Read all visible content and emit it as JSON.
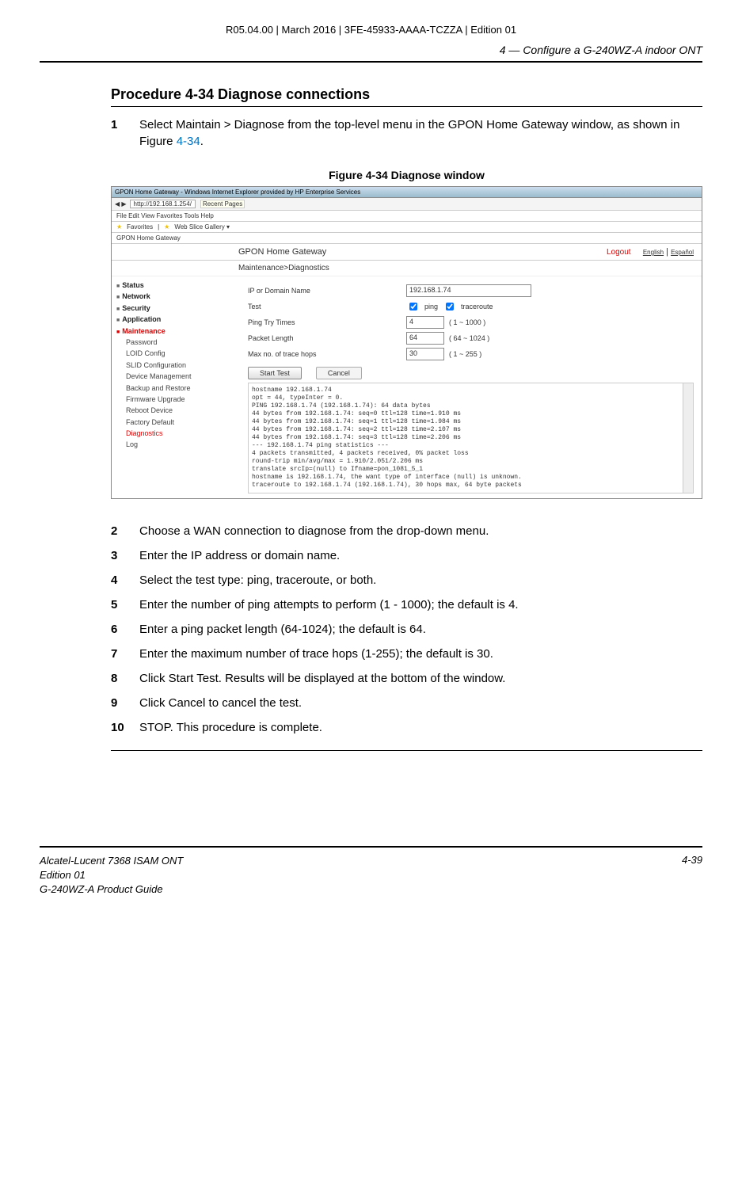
{
  "header": {
    "doc_id_line": "R05.04.00 | March 2016 | 3FE-45933-AAAA-TCZZA | Edition 01",
    "chapter": "4 —  Configure a G-240WZ-A indoor ONT"
  },
  "procedure": {
    "title": "Procedure 4-34  Diagnose connections",
    "steps": [
      {
        "num": "1",
        "text_a": "Select Maintain > Diagnose from the top-level menu in the GPON Home Gateway window, as shown in Figure ",
        "ref": "4-34",
        "text_b": "."
      },
      {
        "num": "2",
        "text_a": "Choose a WAN connection to diagnose from the drop-down menu."
      },
      {
        "num": "3",
        "text_a": "Enter the IP address or domain name."
      },
      {
        "num": "4",
        "text_a": "Select the test type: ping, traceroute, or both."
      },
      {
        "num": "5",
        "text_a": "Enter the number of ping attempts to perform (1 - 1000); the default is 4."
      },
      {
        "num": "6",
        "text_a": "Enter a ping packet length (64-1024); the default is 64."
      },
      {
        "num": "7",
        "text_a": "Enter the maximum number of trace hops (1-255); the default is 30."
      },
      {
        "num": "8",
        "text_a": "Click Start Test. Results will be displayed at the bottom of the window."
      },
      {
        "num": "9",
        "text_a": "Click Cancel to cancel the test."
      },
      {
        "num": "10",
        "text_a": "STOP. This procedure is complete."
      }
    ]
  },
  "figure": {
    "caption": "Figure 4-34  Diagnose window"
  },
  "ss": {
    "titlebar": "GPON Home Gateway - Windows Internet Explorer provided by HP Enterprise Services",
    "addr": "http://192.168.1.254/",
    "recent": "Recent Pages",
    "menu": "File   Edit   View   Favorites   Tools   Help",
    "fav_label": "Favorites",
    "web_slice": "Web Slice Gallery ▾",
    "tab": "GPON Home Gateway",
    "banner_title": "GPON Home Gateway",
    "logout": "Logout",
    "lang_en": "English",
    "lang_es": "Español",
    "breadcrumb": "Maintenance>Diagnostics",
    "side": {
      "status": "Status",
      "network": "Network",
      "security": "Security",
      "application": "Application",
      "maintenance": "Maintenance",
      "subs": [
        "Password",
        "LOID Config",
        "SLID Configuration",
        "Device Management",
        "Backup and Restore",
        "Firmware Upgrade",
        "Reboot Device",
        "Factory Default",
        "Diagnostics",
        "Log"
      ]
    },
    "form": {
      "ip_label": "IP or Domain Name",
      "ip_value": "192.168.1.74",
      "test_label": "Test",
      "ping": "ping",
      "traceroute": "traceroute",
      "tries_label": "Ping Try Times",
      "tries_value": "4",
      "tries_range": "( 1 ~ 1000 )",
      "len_label": "Packet Length",
      "len_value": "64",
      "len_range": "( 64 ~ 1024 )",
      "hops_label": "Max no. of trace hops",
      "hops_value": "30",
      "hops_range": "( 1 ~ 255 )",
      "start": "Start Test",
      "cancel": "Cancel"
    },
    "results": "hostname 192.168.1.74\nopt = 44, typeInter = 0.\nPING 192.168.1.74 (192.168.1.74): 64 data bytes\n44 bytes from 192.168.1.74: seq=0 ttl=128 time=1.910 ms\n44 bytes from 192.168.1.74: seq=1 ttl=128 time=1.984 ms\n44 bytes from 192.168.1.74: seq=2 ttl=128 time=2.107 ms\n44 bytes from 192.168.1.74: seq=3 ttl=128 time=2.206 ms\n--- 192.168.1.74 ping statistics ---\n4 packets transmitted, 4 packets received, 0% packet loss\nround-trip min/avg/max = 1.910/2.051/2.206 ms\ntranslate srcIp=(null) to Ifname=pon_1081_5_1\nhostname is 192.168.1.74, the want type of interface (null) is unknown.\ntraceroute to 192.168.1.74 (192.168.1.74), 30 hops max, 64 byte packets"
  },
  "footer": {
    "l1": "Alcatel-Lucent 7368 ISAM ONT",
    "l2": "Edition 01",
    "l3": "G-240WZ-A Product Guide",
    "page": "4-39"
  }
}
